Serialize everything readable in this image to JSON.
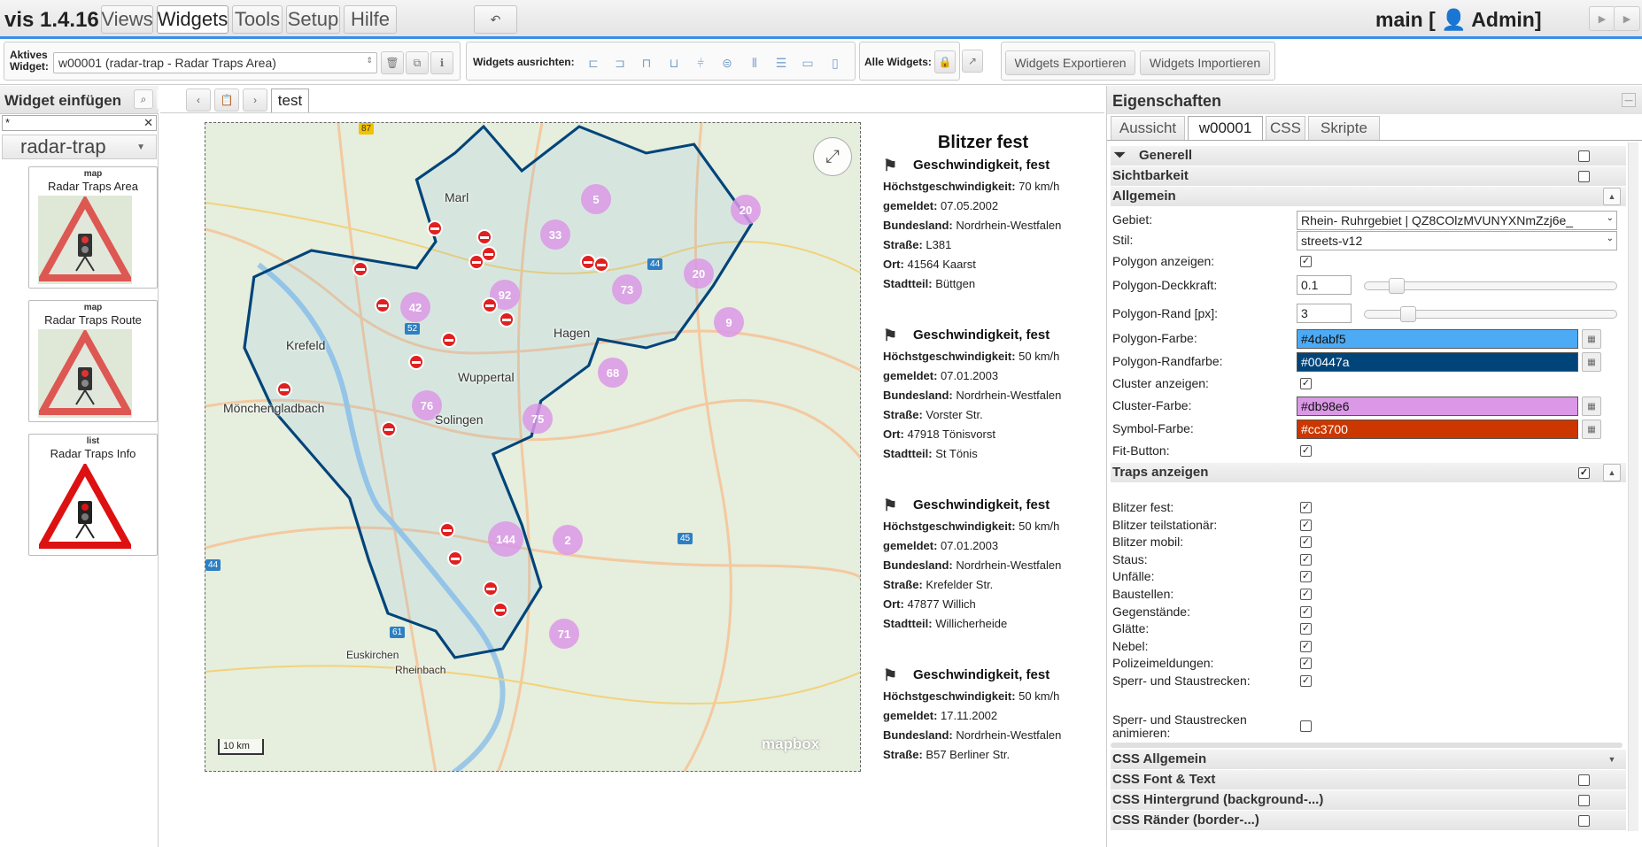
{
  "menubar": {
    "brand": "vis 1.4.16",
    "tabs": [
      "Views",
      "Widgets",
      "Tools",
      "Setup",
      "Hilfe"
    ],
    "active_tab": "Widgets",
    "project": "main [ 👤 Admin]"
  },
  "toolbar": {
    "active_widget_label_1": "Aktives",
    "active_widget_label_2": "Widget:",
    "active_widget_value": "w00001 (radar-trap - Radar Traps Area)",
    "align_label": "Widgets ausrichten:",
    "all_widgets_label": "Alle Widgets:",
    "export_label": "Widgets Exportieren",
    "import_label": "Widgets Importieren"
  },
  "left_panel": {
    "title": "Widget einfügen",
    "filter_value": "*",
    "widget_set": "radar-trap",
    "widgets": [
      {
        "type": "map",
        "name": "Radar Traps Area"
      },
      {
        "type": "map",
        "name": "Radar Traps Route"
      },
      {
        "type": "list",
        "name": "Radar Traps Info"
      }
    ]
  },
  "view_tab": "test",
  "map": {
    "clusters": [
      {
        "label": "5"
      },
      {
        "label": "20"
      },
      {
        "label": "33"
      },
      {
        "label": "20"
      },
      {
        "label": "92"
      },
      {
        "label": "73"
      },
      {
        "label": "42"
      },
      {
        "label": "9"
      },
      {
        "label": "68"
      },
      {
        "label": "76"
      },
      {
        "label": "75"
      },
      {
        "label": "144"
      },
      {
        "label": "2"
      },
      {
        "label": "71"
      }
    ],
    "cities": [
      "Marl",
      "Krefeld",
      "Hagen",
      "Wuppertal",
      "Mönchengladbach",
      "Solingen",
      "Euskirchen",
      "Rheinbach"
    ],
    "road_shields": [
      "87",
      "52",
      "44",
      "45",
      "61",
      "44"
    ],
    "scale_label": "10 km",
    "logo": "mapbox",
    "colors": {
      "polygon_fill": "#4dabf5",
      "polygon_border": "#00447a",
      "cluster": "#db98e6",
      "symbol": "#cc3700"
    }
  },
  "info_list": {
    "title": "Blitzer fest",
    "entries": [
      {
        "heading": "Geschwindigkeit, fest",
        "speed_label": "Höchstgeschwindigkeit:",
        "speed": "70 km/h",
        "reported_label": "gemeldet:",
        "reported": "07.05.2002",
        "state_label": "Bundesland:",
        "state": "Nordrhein-Westfalen",
        "street_label": "Straße:",
        "street": "L381",
        "place_label": "Ort:",
        "place": "41564 Kaarst",
        "district_label": "Stadtteil:",
        "district": "Büttgen"
      },
      {
        "heading": "Geschwindigkeit, fest",
        "speed_label": "Höchstgeschwindigkeit:",
        "speed": "50 km/h",
        "reported_label": "gemeldet:",
        "reported": "07.01.2003",
        "state_label": "Bundesland:",
        "state": "Nordrhein-Westfalen",
        "street_label": "Straße:",
        "street": "Vorster Str.",
        "place_label": "Ort:",
        "place": "47918 Tönisvorst",
        "district_label": "Stadtteil:",
        "district": "St Tönis"
      },
      {
        "heading": "Geschwindigkeit, fest",
        "speed_label": "Höchstgeschwindigkeit:",
        "speed": "50 km/h",
        "reported_label": "gemeldet:",
        "reported": "07.01.2003",
        "state_label": "Bundesland:",
        "state": "Nordrhein-Westfalen",
        "street_label": "Straße:",
        "street": "Krefelder Str.",
        "place_label": "Ort:",
        "place": "47877 Willich",
        "district_label": "Stadtteil:",
        "district": "Willicherheide"
      },
      {
        "heading": "Geschwindigkeit, fest",
        "speed_label": "Höchstgeschwindigkeit:",
        "speed": "50 km/h",
        "reported_label": "gemeldet:",
        "reported": "17.11.2002",
        "state_label": "Bundesland:",
        "state": "Nordrhein-Westfalen",
        "street_label": "Straße:",
        "street": "B57 Berliner Str."
      }
    ]
  },
  "properties": {
    "title": "Eigenschaften",
    "tabs": [
      "Aussicht",
      "w00001",
      "CSS",
      "Skripte"
    ],
    "active_tab": "w00001",
    "groups": {
      "generell": "Generell",
      "sichtbarkeit": "Sichtbarkeit",
      "allgemein": "Allgemein",
      "traps": "Traps anzeigen",
      "css_allgemein": "CSS Allgemein",
      "css_font": "CSS Font & Text",
      "css_bg": "CSS Hintergrund (background-...)",
      "css_border": "CSS Ränder (border-...)"
    },
    "gebiet_label": "Gebiet:",
    "gebiet_value": "Rhein- Ruhrgebiet | QZ8COlzMVUNYXNmZzj6e_",
    "stil_label": "Stil:",
    "stil_value": "streets-v12",
    "polygon_show_label": "Polygon anzeigen:",
    "polygon_opacity_label": "Polygon-Deckkraft:",
    "polygon_opacity": "0.1",
    "polygon_opacity_fraction": 0.1,
    "polygon_border_label": "Polygon-Rand [px]:",
    "polygon_border": "3",
    "polygon_border_fraction": 0.15,
    "polygon_color_label": "Polygon-Farbe:",
    "polygon_color": "#4dabf5",
    "polygon_border_color_label": "Polygon-Randfarbe:",
    "polygon_border_color": "#00447a",
    "cluster_show_label": "Cluster anzeigen:",
    "cluster_color_label": "Cluster-Farbe:",
    "cluster_color": "#db98e6",
    "symbol_color_label": "Symbol-Farbe:",
    "symbol_color": "#cc3700",
    "fit_label": "Fit-Button:",
    "traps": [
      {
        "label": "Blitzer fest:",
        "checked": true
      },
      {
        "label": "Blitzer teilstationär:",
        "checked": true
      },
      {
        "label": "Blitzer mobil:",
        "checked": true
      },
      {
        "label": "Staus:",
        "checked": true
      },
      {
        "label": "Unfälle:",
        "checked": true
      },
      {
        "label": "Baustellen:",
        "checked": true
      },
      {
        "label": "Gegenstände:",
        "checked": true
      },
      {
        "label": "Glätte:",
        "checked": true
      },
      {
        "label": "Nebel:",
        "checked": true
      },
      {
        "label": "Polizeimeldungen:",
        "checked": true
      },
      {
        "label": "Sperr- und Staustrecken:",
        "checked": true
      }
    ],
    "animate_label_1": "Sperr- und Staustrecken",
    "animate_label_2": "animieren:"
  }
}
